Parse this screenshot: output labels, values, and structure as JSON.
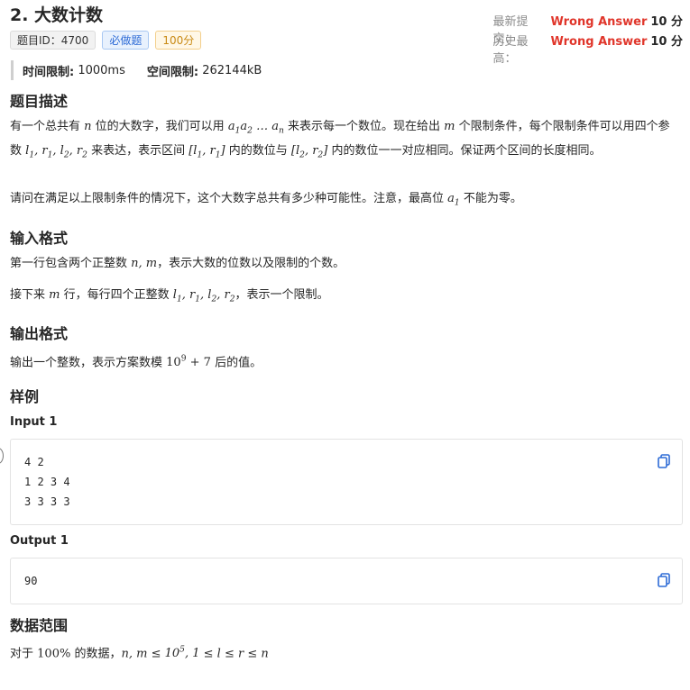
{
  "problem": {
    "title": "2. 大数计数",
    "tags": {
      "id": "题目ID：4700",
      "must": "必做题",
      "score": "100分"
    }
  },
  "status": {
    "latest_label": "最新提交：",
    "latest_result": "Wrong Answer",
    "latest_score": "10 分",
    "best_label": "历史最高：",
    "best_result": "Wrong Answer",
    "best_score": "10 分"
  },
  "limits": {
    "time_label": "时间限制:",
    "time_value": "1000ms",
    "memory_label": "空间限制:",
    "memory_value": "262144kB"
  },
  "sections": {
    "description": "题目描述",
    "input_format": "输入格式",
    "output_format": "输出格式",
    "examples": "样例",
    "data_range": "数据范围"
  },
  "text": {
    "d1a": "有一个总共有",
    "d1b": "位的大数字，我们可以用",
    "d1c": "来表示每一个数位。现在给出",
    "d1d": "个限制条件，每个限制条件可以用四个参数",
    "d1e": "来表达，表示区间",
    "d1f": "内的数位与",
    "d1g": "内的数位一一对应相同。保证两个区间的长度相同。",
    "d2a": "请问在满足以上限制条件的情况下，这个大数字总共有多少种可能性。注意，最高位",
    "d2b": "不能为零。",
    "in1a": "第一行包含两个正整数",
    "in1b": "，表示大数的位数以及限制的个数。",
    "in2a": "接下来",
    "in2b": "行，每行四个正整数",
    "in2c": "，表示一个限制。",
    "out1a": "输出一个整数，表示方案数模",
    "out1b": "后的值。",
    "range_a": "对于",
    "range_b": "的数据，"
  },
  "examples": [
    {
      "label": "Input 1",
      "content": "4 2\n1 2 3 4\n3 3 3 3"
    },
    {
      "label": "Output 1",
      "content": "90"
    }
  ],
  "icons": {
    "copy": "copy-icon"
  },
  "colors": {
    "error": "#e0362b",
    "tag_blue": "#2d6bd6",
    "tag_orange": "#c98a14"
  }
}
